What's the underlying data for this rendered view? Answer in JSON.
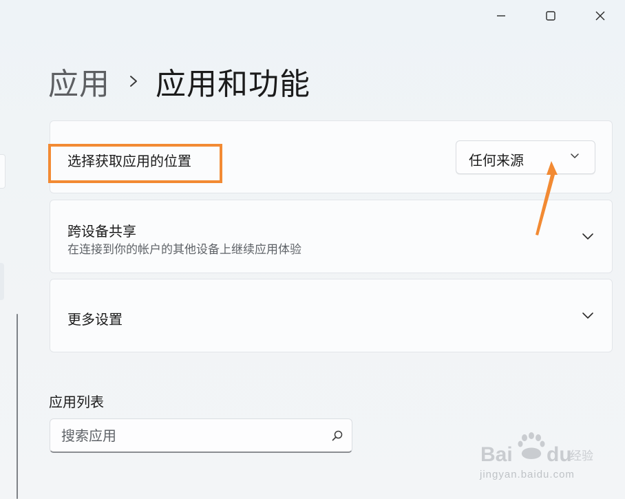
{
  "window_controls": {
    "minimize_icon": "minimize-icon",
    "maximize_icon": "maximize-icon",
    "close_icon": "close-icon"
  },
  "breadcrumb": {
    "parent": "应用",
    "separator_icon": "chevron-right-icon",
    "current": "应用和功能"
  },
  "settings": {
    "app_source": {
      "title": "选择获取应用的位置",
      "dropdown_value": "任何来源"
    },
    "cross_device_sharing": {
      "title": "跨设备共享",
      "description": "在连接到你的帐户的其他设备上继续应用体验"
    },
    "more_settings": {
      "title": "更多设置"
    }
  },
  "app_list": {
    "title": "应用列表",
    "search_placeholder": "搜索应用",
    "search_value": ""
  },
  "watermark": {
    "brand": "Baidu经验",
    "domain": "jingyan.baidu.com"
  },
  "colors": {
    "accent_annotation": "#f28a33",
    "card_background": "#fbfcfd",
    "card_border": "#e2e5e9",
    "text_primary": "#1b1b1b",
    "text_secondary": "#5f6368"
  }
}
